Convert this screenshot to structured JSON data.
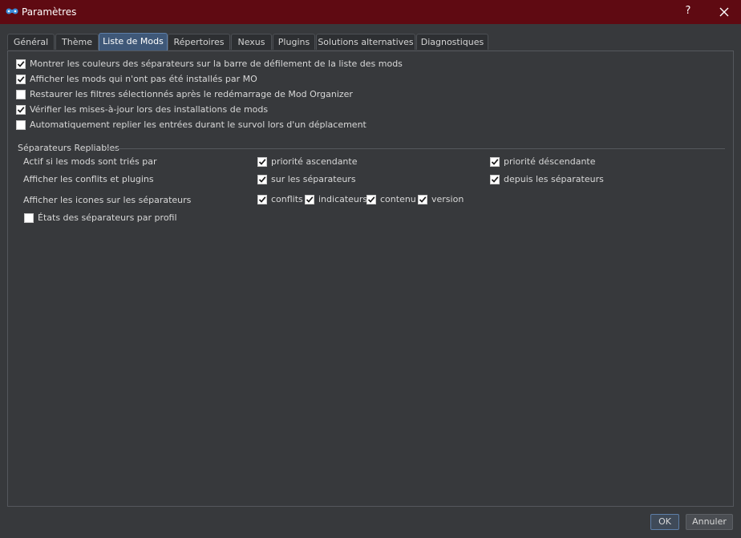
{
  "window": {
    "title": "Paramètres",
    "help_label": "?",
    "close_icon": "close-icon",
    "app_icon": "mod-organizer-logo-icon"
  },
  "tabs": [
    {
      "label": "Général",
      "active": false
    },
    {
      "label": "Thème",
      "active": false
    },
    {
      "label": "Liste de Mods",
      "active": true
    },
    {
      "label": "Répertoires",
      "active": false
    },
    {
      "label": "Nexus",
      "active": false
    },
    {
      "label": "Plugins",
      "active": false
    },
    {
      "label": "Solutions alternatives",
      "active": false
    },
    {
      "label": "Diagnostiques",
      "active": false
    }
  ],
  "options": [
    {
      "label": "Montrer les couleurs des séparateurs sur la barre de défilement de la liste des mods",
      "checked": true
    },
    {
      "label": "Afficher les mods qui n'ont pas été installés par MO",
      "checked": true
    },
    {
      "label": "Restaurer les filtres sélectionnés après le redémarrage de Mod Organizer",
      "checked": false
    },
    {
      "label": "Vérifier les mises-à-jour lors des installations de mods",
      "checked": true
    },
    {
      "label": "Automatiquement replier les entrées durant le survol lors d'un déplacement",
      "checked": false
    }
  ],
  "collapsible": {
    "title": "Séparateurs Repliables",
    "active_row": {
      "label": "Actif si les mods sont triés par",
      "ascending": {
        "label": "priorité ascendante",
        "checked": true
      },
      "descending": {
        "label": "priorité déscendante",
        "checked": true
      }
    },
    "conflicts_row": {
      "label": "Afficher les conflits et plugins",
      "on_separators": {
        "label": "sur les séparateurs",
        "checked": true
      },
      "from_separators": {
        "label": "depuis les séparateurs",
        "checked": true
      }
    },
    "icons_row": {
      "label": "Afficher les icones sur les séparateurs",
      "items": [
        {
          "label": "conflits",
          "checked": true
        },
        {
          "label": "indicateurs",
          "checked": true
        },
        {
          "label": "contenu",
          "checked": true
        },
        {
          "label": "version",
          "checked": true
        }
      ]
    },
    "per_profile": {
      "label": "États des séparateurs par profil",
      "checked": false
    }
  },
  "buttons": {
    "ok": "OK",
    "cancel": "Annuler"
  },
  "colors": {
    "titlebar": "#5f0a12",
    "background": "#37393c",
    "active_tab": "#3f5878"
  }
}
